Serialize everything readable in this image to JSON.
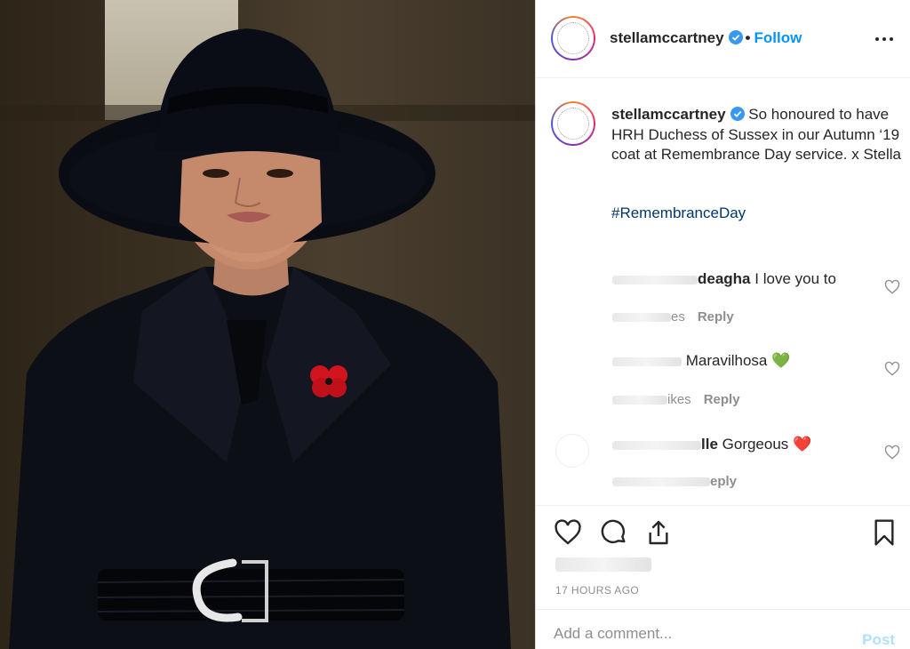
{
  "post": {
    "username": "stellamccartney",
    "follow_label": "Follow",
    "separator": "•",
    "caption": "So honoured to have HRH Duchess of Sussex in our Autumn ‘19 coat at Remembrance Day service. x Stella",
    "hashtag": "#RemembranceDay",
    "timestamp": "17 HOURS AGO"
  },
  "comments": [
    {
      "user_partial": "deagha",
      "text": "I love you to",
      "likes_partial": "es",
      "reply_label": "Reply"
    },
    {
      "user_partial": "",
      "text": "Maravilhosa 💚",
      "likes_partial": "ikes",
      "reply_label": "Reply"
    },
    {
      "user_partial": "lle",
      "text": "Gorgeous ❤️",
      "likes_partial": "",
      "reply_label": "eply"
    }
  ],
  "composer": {
    "placeholder": "Add a comment...",
    "post_label": "Post"
  },
  "colors": {
    "link_blue": "#0095f6",
    "hashtag_blue": "#00376b",
    "muted_gray": "#8e8e8e",
    "post_disabled": "#b2dffc",
    "verified_blue": "#3897f0",
    "poppy_red": "#d2141e"
  },
  "icons": {
    "verified": "verified-badge-icon",
    "more": "more-options-icon",
    "like": "heart-icon",
    "comment": "comment-bubble-icon",
    "share": "share-icon",
    "save": "bookmark-icon"
  }
}
